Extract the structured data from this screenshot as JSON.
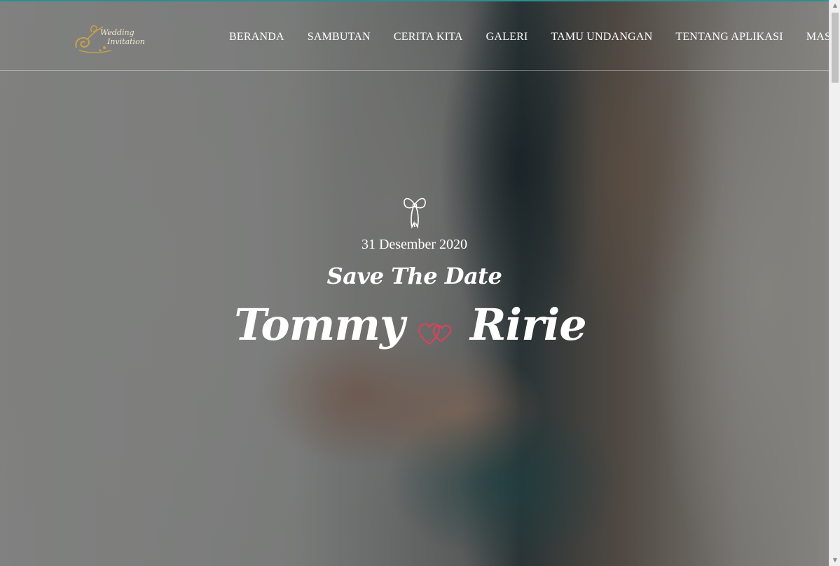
{
  "logo": {
    "text_line1": "Wedding",
    "text_line2": "Invitation",
    "icon": "swirl-logo-icon"
  },
  "nav": {
    "items": [
      {
        "label": "BERANDA"
      },
      {
        "label": "SAMBUTAN"
      },
      {
        "label": "CERITA KITA"
      },
      {
        "label": "GALERI"
      },
      {
        "label": "TAMU UNDANGAN"
      },
      {
        "label": "TENTANG APLIKASI"
      },
      {
        "label": "MASUK"
      }
    ]
  },
  "hero": {
    "icon": "ribbon-bow-icon",
    "date": "31 Desember 2020",
    "tagline": "Save The Date",
    "groom": "Tommy",
    "bride": "Ririe",
    "divider_icon": "hearts-icon"
  },
  "colors": {
    "accent": "#2a8f8f",
    "heart": "#e0405a",
    "text": "#ffffff",
    "logo_gold": "#c9a24a"
  }
}
